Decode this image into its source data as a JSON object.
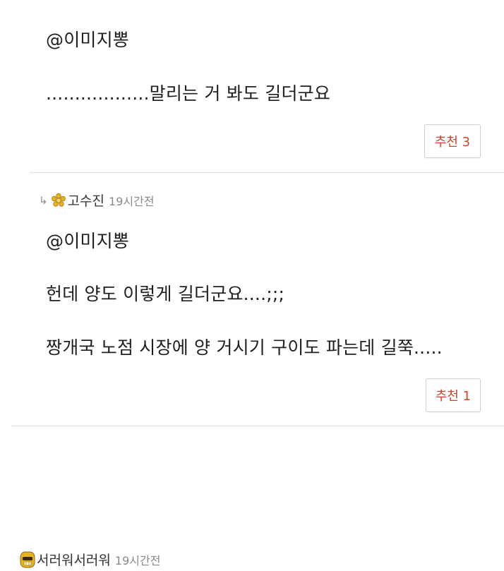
{
  "comments": [
    {
      "mention": "@이미지뽕",
      "lines": [
        "..................말리는 거 봐도 길더군요"
      ],
      "recommend_label": "추천 3"
    },
    {
      "reply_icon": "reply-arrow-icon",
      "badge_icon": "flower-badge-icon",
      "user": "고수진",
      "time": "19시간전",
      "mention": "@이미지뽕",
      "lines": [
        "헌데 양도 이렇게 길더군요....;;;",
        "짱개국 노점 시장에 양 거시기 구이도 파는데 길쭉....."
      ],
      "recommend_label": "추천 1"
    },
    {
      "badge_icon": "avatar-badge-icon",
      "user": "서러워서러워",
      "time": "19시간전"
    }
  ],
  "colors": {
    "recommend_text": "#c14a2e",
    "divider": "#e2e2e2",
    "time_text": "#8a8a8a",
    "badge_gold": "#e6b422"
  }
}
